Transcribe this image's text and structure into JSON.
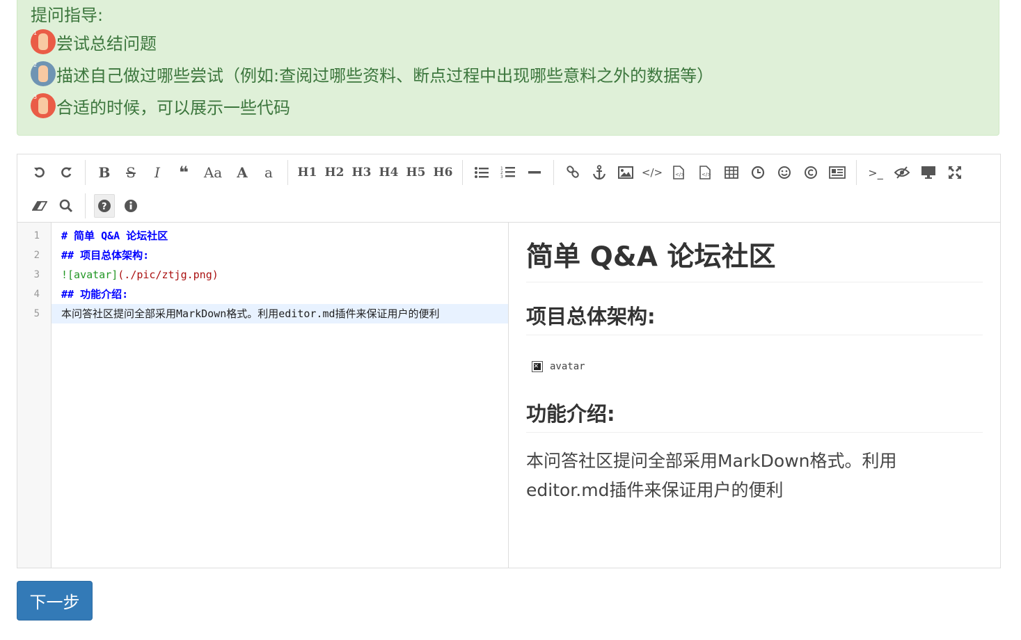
{
  "guide": {
    "title": "提问指导:",
    "items": [
      {
        "label": "尝试总结问题",
        "badge": "1",
        "badge_color": "#ea5c47"
      },
      {
        "label": "描述自己做过哪些尝试（例如:查阅过哪些资料、断点过程中出现哪些意料之外的数据等）",
        "badge": "2",
        "badge_color": "#6f94b3"
      },
      {
        "label": "合适的时候，可以展示一些代码",
        "badge": "3",
        "badge_color": "#ea5c47"
      }
    ],
    "bg_color": "#dff0d8",
    "text_color": "#3c763d"
  },
  "toolbar": {
    "row1": [
      {
        "icon": "undo-icon",
        "glyph": "↶"
      },
      {
        "icon": "redo-icon",
        "glyph": "↷"
      },
      {
        "icon": "bold-icon",
        "glyph": "B"
      },
      {
        "icon": "strikethrough-icon",
        "glyph": "S"
      },
      {
        "icon": "italic-icon",
        "glyph": "I"
      },
      {
        "icon": "quote-icon",
        "glyph": "❝"
      },
      {
        "icon": "uppercase-icon",
        "glyph": "Aa"
      },
      {
        "icon": "ucwords-icon",
        "glyph": "A"
      },
      {
        "icon": "lowercase-icon",
        "glyph": "a"
      },
      {
        "icon": "h1-icon",
        "glyph": "H1"
      },
      {
        "icon": "h2-icon",
        "glyph": "H2"
      },
      {
        "icon": "h3-icon",
        "glyph": "H3"
      },
      {
        "icon": "h4-icon",
        "glyph": "H4"
      },
      {
        "icon": "h5-icon",
        "glyph": "H5"
      },
      {
        "icon": "h6-icon",
        "glyph": "H6"
      }
    ]
  },
  "code": {
    "line_numbers": [
      "1",
      "2",
      "3",
      "4",
      "5"
    ],
    "line1": "# 简单 Q&A 论坛社区",
    "line2": "## 项目总体架构:",
    "line3_bang": "![avatar]",
    "line3_url": "(./pic/ztjg.png)",
    "line4": "## 功能介绍:",
    "line5": "本问答社区提问全部采用MarkDown格式。利用editor.md插件来保证用户的便利"
  },
  "preview": {
    "h1": "简单 Q&A 论坛社区",
    "h2_arch": "项目总体架构:",
    "img_alt": "avatar",
    "h2_features": "功能介绍:",
    "paragraph": "本问答社区提问全部采用MarkDown格式。利用editor.md插件来保证用户的便利"
  },
  "next_button": {
    "label": "下一步",
    "color": "#337ab7"
  }
}
